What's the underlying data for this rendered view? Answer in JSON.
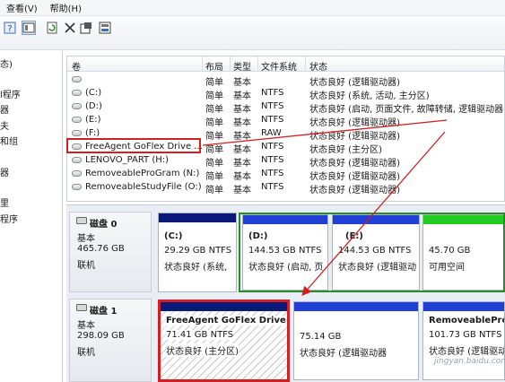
{
  "menu": [
    "查看(V)",
    "帮助(H)"
  ],
  "nav_items": [
    "态)",
    "l程序",
    "器",
    "夫",
    "和组",
    "器",
    "里",
    "程序"
  ],
  "columns": [
    "卷",
    "布局",
    "类型",
    "文件系统",
    "状态"
  ],
  "volumes": [
    {
      "name": "",
      "layout": "简单",
      "type": "基本",
      "fs": "",
      "status": "状态良好 (逻辑驱动器)"
    },
    {
      "name": "(C:)",
      "layout": "简单",
      "type": "基本",
      "fs": "NTFS",
      "status": "状态良好 (系统, 活动, 主分区)"
    },
    {
      "name": "(D:)",
      "layout": "简单",
      "type": "基本",
      "fs": "NTFS",
      "status": "状态良好 (启动, 页面文件, 故障转储, 逻辑驱动器"
    },
    {
      "name": "(E:)",
      "layout": "简单",
      "type": "基本",
      "fs": "NTFS",
      "status": "状态良好 (逻辑驱动器)"
    },
    {
      "name": "(F:)",
      "layout": "简单",
      "type": "基本",
      "fs": "RAW",
      "status": "状态良好 (逻辑驱动器)"
    },
    {
      "name": "FreeAgent GoFlex Drive ...",
      "layout": "简单",
      "type": "基本",
      "fs": "NTFS",
      "status": "状态良好 (主分区)"
    },
    {
      "name": "LENOVO_PART (H:)",
      "layout": "简单",
      "type": "基本",
      "fs": "NTFS",
      "status": "状态良好 (逻辑驱动器)"
    },
    {
      "name": "RemoveableProGram (N:)",
      "layout": "简单",
      "type": "基本",
      "fs": "NTFS",
      "status": "状态良好 (逻辑驱动器)"
    },
    {
      "name": "RemoveableStudyFile (O:)",
      "layout": "简单",
      "type": "基本",
      "fs": "NTFS",
      "status": "状态良好 (逻辑驱动器)"
    }
  ],
  "disks": [
    {
      "title": "磁盘 0",
      "kind": "基本",
      "size": "465.76 GB",
      "state": "联机",
      "partitions": [
        {
          "name": "(C:)",
          "size": "29.29 GB NTFS",
          "status": "状态良好 (系统,",
          "bar": "#0a1a7a"
        },
        {
          "name": "(D:)",
          "size": "144.53 GB NTFS",
          "status": "状态良好 (启动, 页",
          "bar": "#1f3fd6"
        },
        {
          "name": "(E:)",
          "size": "144.53 GB NTFS",
          "status": "状态良好 (逻辑驱动",
          "bar": "#1f3fd6"
        },
        {
          "name": "",
          "size": "45.70 GB",
          "status": "可用空间",
          "bar": "#22cc22"
        }
      ]
    },
    {
      "title": "磁盘 1",
      "kind": "基本",
      "size": "298.09 GB",
      "state": "联机",
      "partitions": [
        {
          "name": "FreeAgent GoFlex Drive",
          "size": "71.41 GB NTFS",
          "status": "状态良好 (主分区)",
          "bar": "#0a1a7a"
        },
        {
          "name": "",
          "size": "75.14 GB",
          "status": "状态良好 (逻辑驱动器",
          "bar": "#1f3fd6"
        },
        {
          "name": "RemoveableProC",
          "size": "101.73 GB NTFS",
          "status": "状态良好 (逻辑驱动",
          "bar": "#1f3fd6"
        }
      ]
    }
  ],
  "watermark": "jingyan.baidu.com",
  "colors": {
    "highlight": "#d11f22",
    "extended": "#2b8a2b",
    "primary": "#0a1a7a",
    "logical": "#1f3fd6",
    "free": "#22cc22"
  }
}
